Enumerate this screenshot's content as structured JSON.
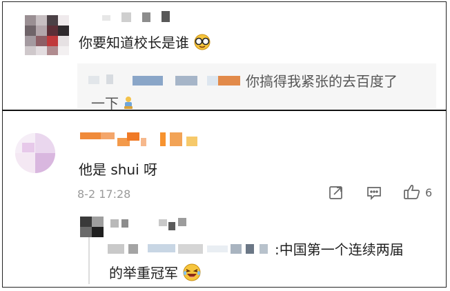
{
  "comment1": {
    "text": "你要知道校长是谁",
    "emoji_icon": "smiling-face-with-glasses-icon",
    "reply": {
      "text_line1": "你搞得我紧张的去百度了",
      "text_line2": "一下",
      "emoji_icon": "bowing-figure-icon"
    }
  },
  "comment2": {
    "text": "他是 shui 呀",
    "timestamp": "8-2 17:28",
    "actions": {
      "share_icon": "share-icon",
      "reply_icon": "comment-icon",
      "like_icon": "thumbs-up-icon",
      "like_count": "6"
    },
    "reply": {
      "text_line1": ":中国第一个连续两届",
      "text_line2": "的举重冠军",
      "emoji_icon": "laughing-face-icon"
    }
  }
}
